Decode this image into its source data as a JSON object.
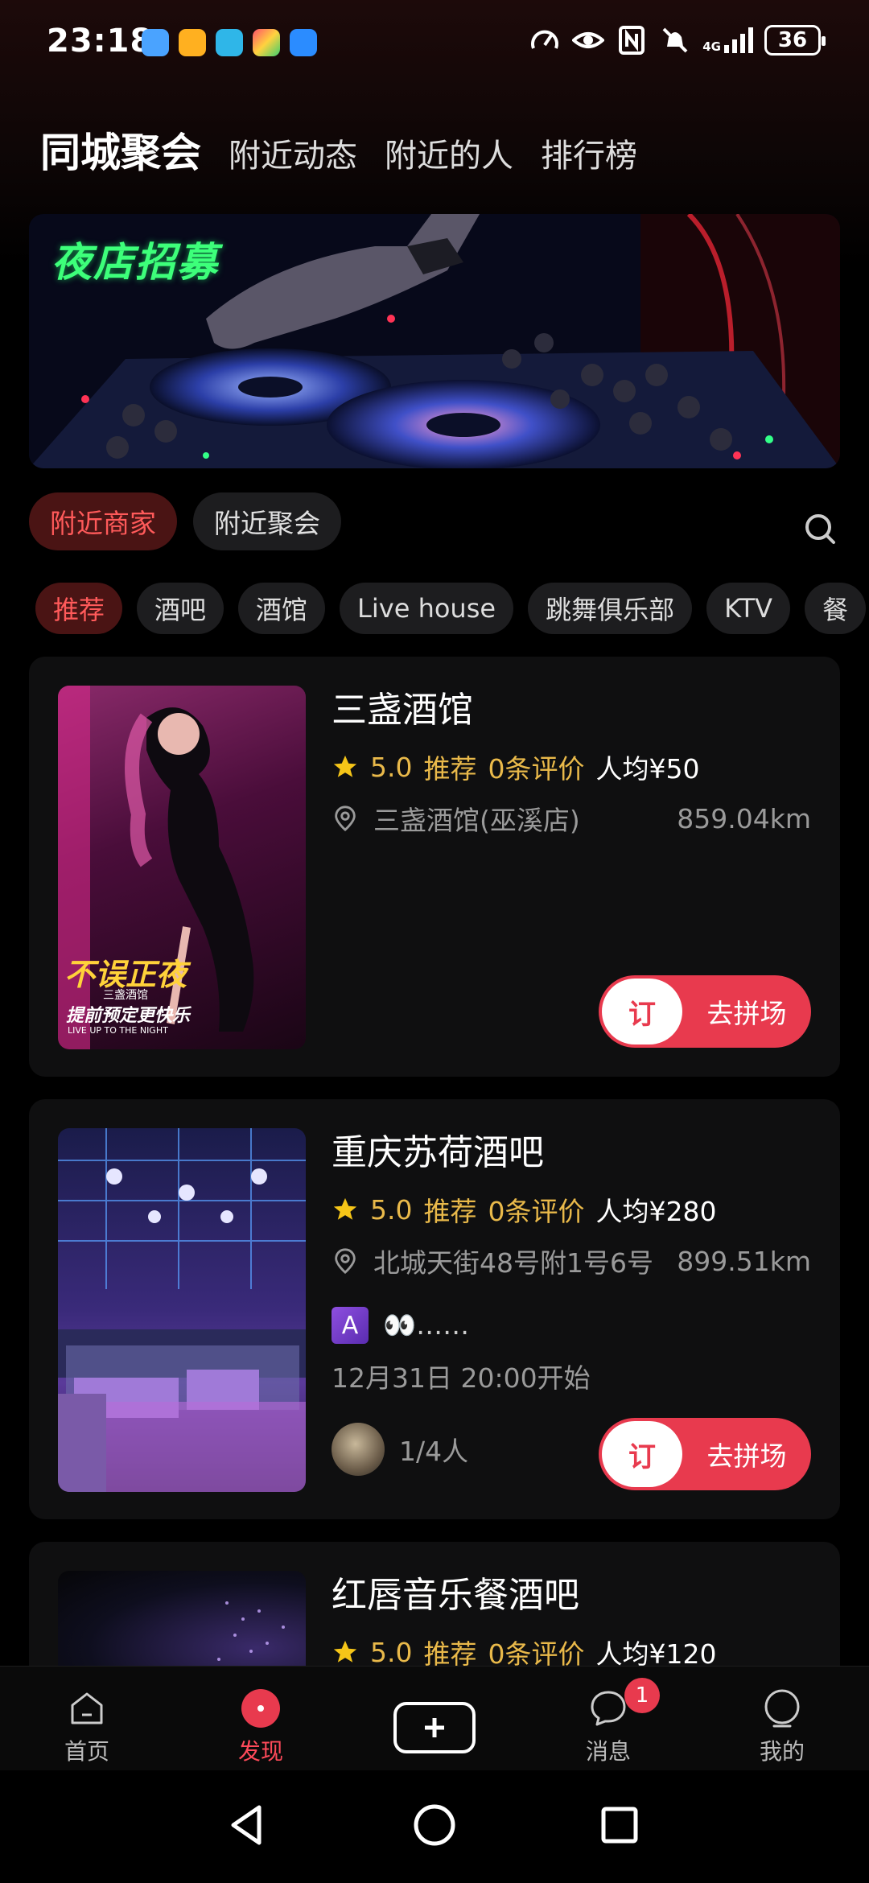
{
  "status_bar": {
    "time": "23:18",
    "network": "4G",
    "battery": "36"
  },
  "top_tabs": [
    {
      "label": "同城聚会",
      "active": true
    },
    {
      "label": "附近动态",
      "active": false
    },
    {
      "label": "附近的人",
      "active": false
    },
    {
      "label": "排行榜",
      "active": false
    }
  ],
  "banner": {
    "title": "夜店招募"
  },
  "filter_chips": [
    {
      "label": "附近商家",
      "active": true
    },
    {
      "label": "附近聚会",
      "active": false
    }
  ],
  "category_chips": [
    {
      "label": "推荐",
      "active": true
    },
    {
      "label": "酒吧"
    },
    {
      "label": "酒馆"
    },
    {
      "label": "Live house"
    },
    {
      "label": "跳舞俱乐部"
    },
    {
      "label": "KTV"
    },
    {
      "label": "餐"
    }
  ],
  "listings": [
    {
      "name": "三盏酒馆",
      "rating": "5.0",
      "recommend": "推荐",
      "reviews": "0条评价",
      "avg_price": "人均¥50",
      "address": "三盏酒馆(巫溪店)",
      "distance": "859.04km",
      "poster_text": "不误正夜",
      "poster_sub": "三盏酒馆",
      "poster_slogan": "提前预定更快乐",
      "poster_en": "LIVE UP TO THE NIGHT",
      "book_icon": "订",
      "book_label": "去拼场"
    },
    {
      "name": "重庆苏荷酒吧",
      "rating": "5.0",
      "recommend": "推荐",
      "reviews": "0条评价",
      "avg_price": "人均¥280",
      "address": "北城天街48号附1号6号",
      "distance": "899.51km",
      "host_badge": "A",
      "host_name": "👀……",
      "start_time": "12月31日 20:00开始",
      "people": "1/4人",
      "book_icon": "订",
      "book_label": "去拼场"
    },
    {
      "name": "红唇音乐餐酒吧",
      "rating": "5.0",
      "recommend": "推荐",
      "reviews": "0条评价",
      "avg_price": "人均¥120"
    }
  ],
  "bottom_nav": [
    {
      "label": "首页",
      "icon": "home-icon"
    },
    {
      "label": "发现",
      "icon": "discover-icon",
      "active": true
    },
    {
      "label": "",
      "icon": "add-icon"
    },
    {
      "label": "消息",
      "icon": "message-icon",
      "badge": "1"
    },
    {
      "label": "我的",
      "icon": "profile-icon"
    }
  ],
  "colors": {
    "accent": "#e83a4e",
    "star": "#e9b94a",
    "chip_active_bg": "#4a1414",
    "chip_active_text": "#ff5a5a"
  }
}
